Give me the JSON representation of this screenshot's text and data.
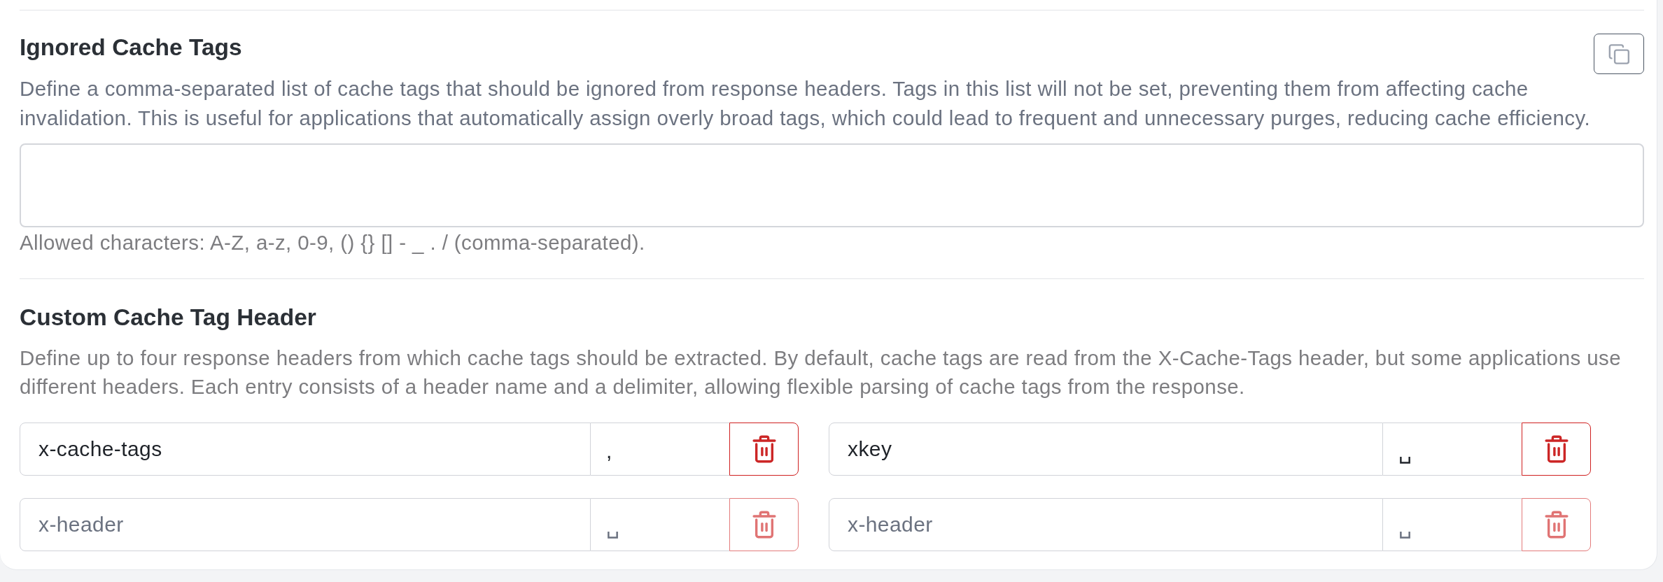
{
  "ignored_cache_tags": {
    "title": "Ignored Cache Tags",
    "copy_button": true,
    "description": "Define a comma-separated list of cache tags that should be ignored from response headers. Tags in this list will not be set, preventing them from affecting cache invalidation. This is useful for applications that automatically assign overly broad tags, which could lead to frequent and unnecessary purges, reducing cache efficiency.",
    "hint": "Allowed characters: A-Z, a-z, 0-9, () {} [] - _ . / (comma-separated)."
  },
  "custom_cache_tag_header": {
    "title": "Custom Cache Tag Header",
    "description": "Define up to four response headers from which cache tags should be extracted. By default, cache tags are read from the X-Cache-Tags header, but some applications use different headers. Each entry consists of a header name and a delimiter, allowing flexible parsing of cache tags from the response.",
    "entries": [
      {
        "name": {
          "value": "x-cache-tags"
        },
        "delimiter": {
          "value": ","
        },
        "remove_disabled": false
      },
      {
        "name": {
          "value": "xkey"
        },
        "delimiter": {
          "value": "␣"
        },
        "remove_disabled": false
      },
      {
        "name": {
          "placeholder": "x-header"
        },
        "delimiter": {
          "placeholder": "␣"
        },
        "remove_disabled": true
      },
      {
        "name": {
          "placeholder": "x-header"
        },
        "delimiter": {
          "placeholder": "␣"
        },
        "remove_disabled": true
      }
    ]
  }
}
